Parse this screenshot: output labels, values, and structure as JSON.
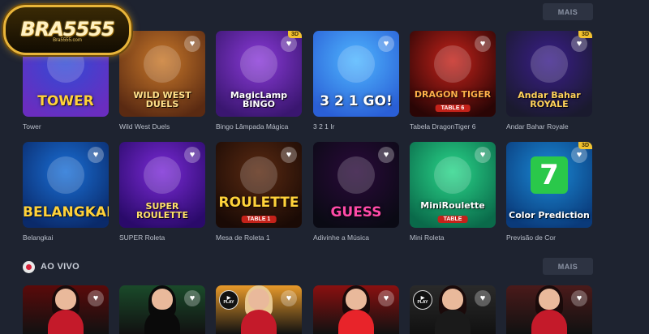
{
  "brand": {
    "logo_text": "BRA5555",
    "logo_sub": "Bra5555.com"
  },
  "top": {
    "more_label": "MAIS"
  },
  "games_row1": [
    {
      "label": "Tower",
      "art": "TOWER",
      "colors": [
        "#2f4bd6",
        "#6a2dbf"
      ],
      "art_color": "#ffd23a",
      "icon": "trophy-icon"
    },
    {
      "label": "Wild West Duels",
      "art": "WILD WEST DUELS",
      "colors": [
        "#c8782a",
        "#5a2a12"
      ],
      "art_color": "#ffe08a",
      "icon": "cowboy-icon"
    },
    {
      "label": "Bingo Lâmpada Mágica",
      "art": "MagicLamp BINGO",
      "colors": [
        "#8a3ad8",
        "#3a1670"
      ],
      "art_color": "#ffffff",
      "icon": "lamp-icon",
      "badge": "3D"
    },
    {
      "label": "3 2 1 Ir",
      "art": "3 2 1 GO!",
      "colors": [
        "#4fb6ff",
        "#2a5fd6"
      ],
      "art_color": "#ffffff",
      "icon": "rocket-icon"
    },
    {
      "label": "Tabela DragonTiger 6",
      "art": "DRAGON TIGER",
      "sub": "TABLE 6",
      "colors": [
        "#c4221a",
        "#2a0505"
      ],
      "art_color": "#ffb04a",
      "icon": "dragon-icon"
    },
    {
      "label": "Andar Bahar Royale",
      "art": "Andar Bahar ROYALE",
      "colors": [
        "#3a1e8a",
        "#1a1a2e"
      ],
      "art_color": "#ffd25a",
      "icon": "woman-icon",
      "badge": "3D"
    }
  ],
  "games_row2": [
    {
      "label": "Belangkai",
      "art": "BELANGKAI",
      "colors": [
        "#1a6fd6",
        "#0a2a6a"
      ],
      "art_color": "#ffd23a",
      "icon": "crab-icon"
    },
    {
      "label": "SUPER Roleta",
      "art": "SUPER ROULETTE",
      "colors": [
        "#7a2ad6",
        "#2a0a6a"
      ],
      "art_color": "#ffe06a",
      "icon": "roulette-icon"
    },
    {
      "label": "Mesa de Roleta 1",
      "art": "ROULETTE",
      "sub": "TABLE 1",
      "colors": [
        "#5a2a12",
        "#1a0a05"
      ],
      "art_color": "#ffd23a",
      "icon": "roulette-wheel-icon"
    },
    {
      "label": "Adivinhe a Música",
      "art": "GUESS",
      "colors": [
        "#2a0a3a",
        "#0a0a14"
      ],
      "art_color": "#ff4aa8",
      "icon": "singer-icon"
    },
    {
      "label": "Mini Roleta",
      "art": "MiniRoulette",
      "sub": "TABLE",
      "colors": [
        "#2ad68a",
        "#0a6a4a"
      ],
      "art_color": "#ffffff",
      "icon": "mini-roulette-icon"
    },
    {
      "label": "Previsão de Cor",
      "art": "Color Prediction",
      "colors": [
        "#1a8ad6",
        "#0a3a7a"
      ],
      "art_color": "#ffffff",
      "icon": "seven-icon",
      "badge": "3D",
      "glyph": "7"
    }
  ],
  "live_section": {
    "title": "AO VIVO",
    "more_label": "MAIS"
  },
  "live_row": [
    {
      "bg": "#5a0a0a",
      "hair": "#1a0a0a",
      "body": "#c41a2a",
      "play": false
    },
    {
      "bg": "#1a4a2a",
      "hair": "#0a0a0a",
      "body": "#0a0a0a",
      "play": false
    },
    {
      "bg": "#e89a2a",
      "hair": "#e8c890",
      "body": "#c41a2a",
      "play": true,
      "play_text": "PLAY"
    },
    {
      "bg": "#8a1010",
      "hair": "#1a0a0a",
      "body": "#e8242a",
      "play": false
    },
    {
      "bg": "#2a2a2a",
      "hair": "#1a0a0a",
      "body": "#1a1a1a",
      "play": true,
      "play_text": "PLAY"
    },
    {
      "bg": "#4a1a1a",
      "hair": "#1a0a0a",
      "body": "#c41a2a",
      "play": false
    }
  ]
}
